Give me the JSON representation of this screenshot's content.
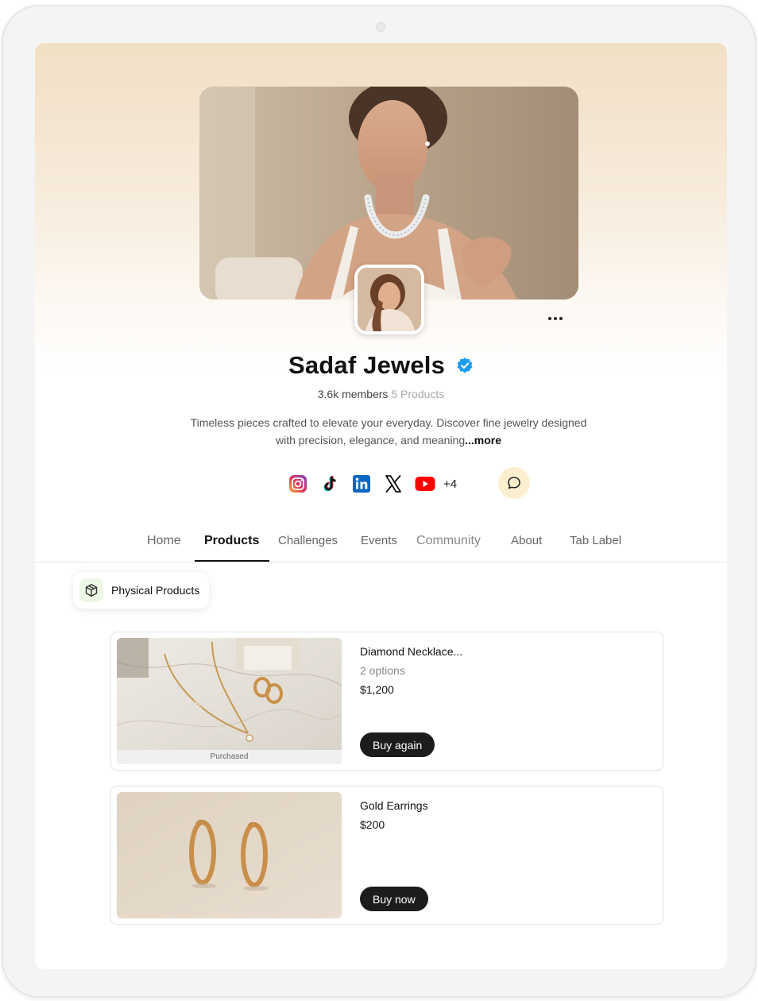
{
  "profile": {
    "name": "Sadaf Jewels",
    "members": "3.6k members",
    "products_count": "5 Products",
    "bio": "Timeless pieces crafted to elevate your everyday. Discover fine jewelry designed with precision, elegance, and meaning",
    "bio_more": "...more",
    "social_extra": "+4"
  },
  "socials": [
    "instagram-icon",
    "tiktok-icon",
    "linkedin-icon",
    "x-icon",
    "youtube-icon"
  ],
  "tabs": {
    "home": "Home",
    "products": "Products",
    "challenges": "Challenges",
    "events": "Events",
    "community": "Community",
    "about": "About",
    "tab_label": "Tab Label"
  },
  "filter_chip": {
    "label": "Physical Products",
    "icon": "box-icon"
  },
  "products": [
    {
      "title": "Diamond Necklace...",
      "options": "2 options",
      "price": "$1,200",
      "badge": "Purchased",
      "button": "Buy again"
    },
    {
      "title": "Gold Earrings",
      "price": "$200",
      "button": "Buy now"
    }
  ],
  "colors": {
    "accent_dark": "#1c1c1c",
    "verified_blue": "#1d9bf0",
    "chat_bg": "#fbefcf",
    "header_gradient_top": "#f2dfc5"
  }
}
